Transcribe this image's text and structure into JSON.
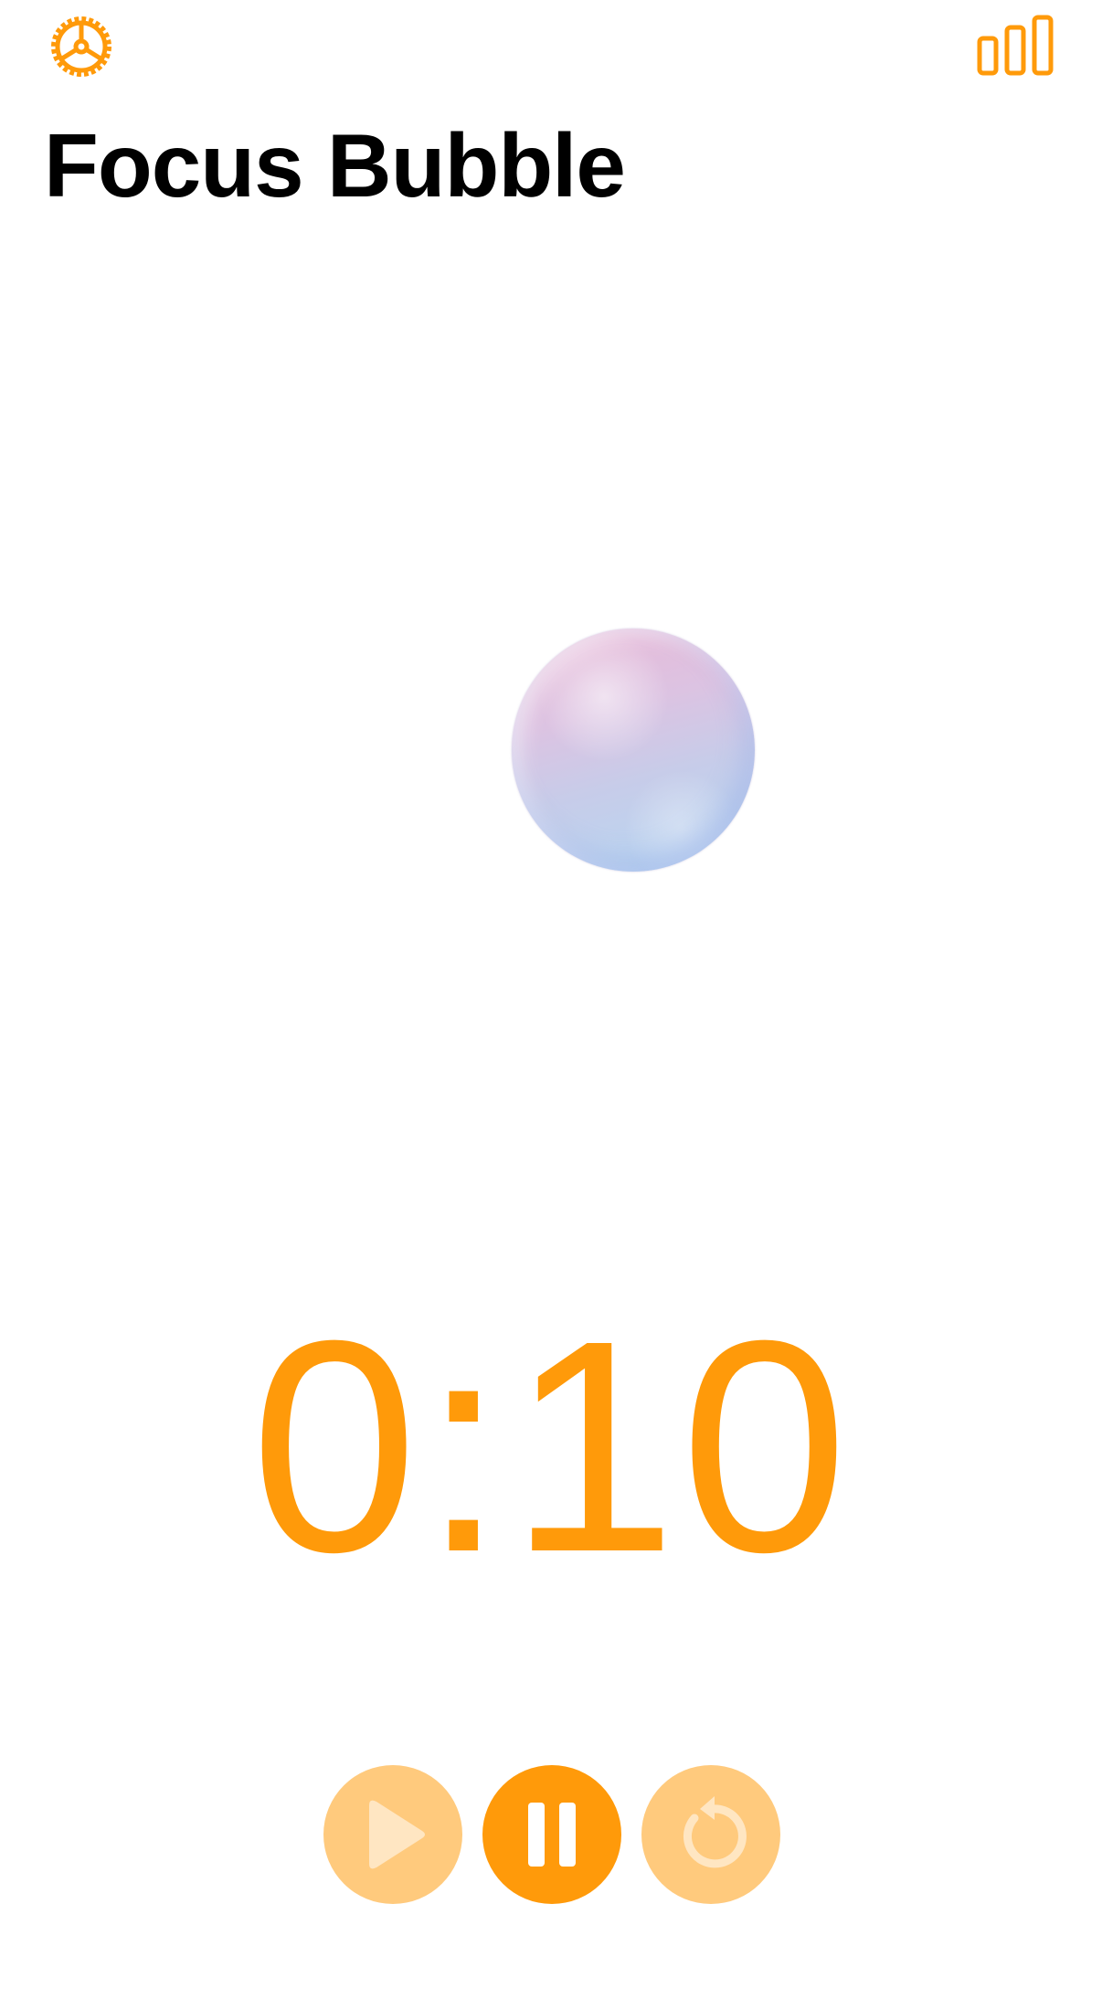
{
  "app": {
    "title": "Focus Bubble"
  },
  "timer": {
    "display": "0:10"
  },
  "header": {
    "settings_icon": "gear-icon",
    "stats_icon": "bar-chart-icon"
  },
  "controls": {
    "play_icon": "play-icon",
    "pause_icon": "pause-icon",
    "reset_icon": "reset-icon",
    "play_enabled": false,
    "pause_enabled": true,
    "reset_enabled": false
  },
  "colors": {
    "accent": "#ff9a0a",
    "accent_disabled": "#ffca7d",
    "title": "#000000",
    "background": "#ffffff"
  }
}
